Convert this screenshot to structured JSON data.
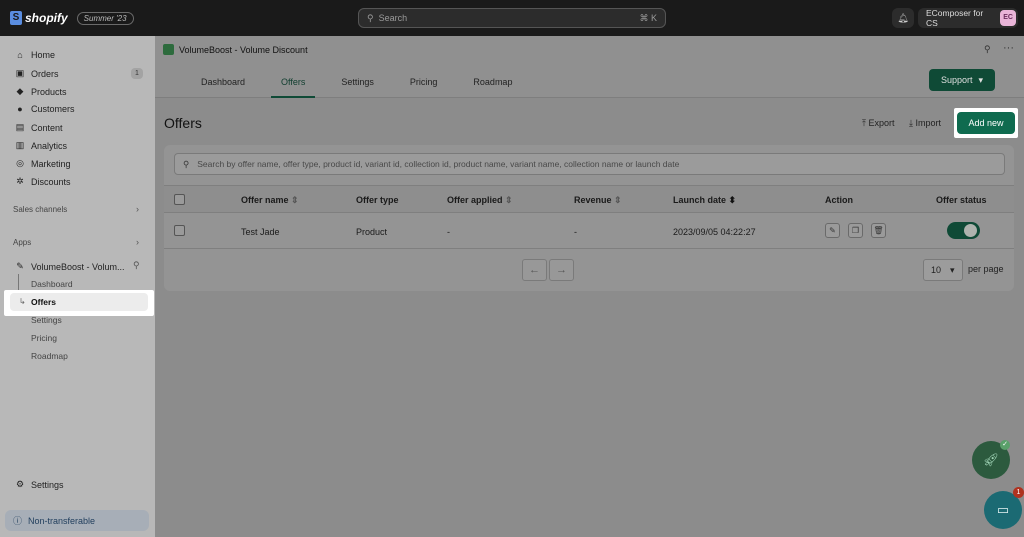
{
  "topbar": {
    "logo_text": "shopify",
    "edition": "Summer '23",
    "search_placeholder": "Search",
    "search_shortcut": "⌘ K",
    "store_name": "EComposer for CS",
    "avatar_initials": "EC"
  },
  "sidebar": {
    "items": [
      {
        "label": "Home",
        "icon": "home-icon"
      },
      {
        "label": "Orders",
        "icon": "orders-icon",
        "badge": "1"
      },
      {
        "label": "Products",
        "icon": "tag-icon"
      },
      {
        "label": "Customers",
        "icon": "person-icon"
      },
      {
        "label": "Content",
        "icon": "content-icon"
      },
      {
        "label": "Analytics",
        "icon": "chart-icon"
      },
      {
        "label": "Marketing",
        "icon": "target-icon"
      },
      {
        "label": "Discounts",
        "icon": "discount-icon"
      }
    ],
    "sales_channels": "Sales channels",
    "apps": "Apps",
    "app_name": "VolumeBoost - Volum...",
    "app_subitems": [
      "Dashboard",
      "Offers",
      "Settings",
      "Pricing",
      "Roadmap"
    ],
    "settings": "Settings",
    "non_transferable": "Non-transferable"
  },
  "app": {
    "title": "VolumeBoost - Volume Discount",
    "tabs": [
      "Dashboard",
      "Offers",
      "Settings",
      "Pricing",
      "Roadmap"
    ],
    "active_tab": "Offers",
    "support_label": "Support"
  },
  "page": {
    "title": "Offers",
    "export_label": "Export",
    "import_label": "Import",
    "add_new_label": "Add new",
    "search_placeholder": "Search by offer name, offer type, product id, variant id, collection id, product name, variant name, collection name or launch date"
  },
  "table": {
    "columns": [
      "Offer name",
      "Offer type",
      "Offer applied",
      "Revenue",
      "Launch date",
      "Action",
      "Offer status"
    ],
    "rows": [
      {
        "name": "Test Jade",
        "type": "Product",
        "applied": "-",
        "revenue": "-",
        "launch_date": "2023/09/05 04:22:27",
        "status_on": true
      }
    ]
  },
  "pagination": {
    "per_page_value": "10",
    "per_page_label": "per page"
  },
  "fab": {
    "notification_count": "1"
  }
}
